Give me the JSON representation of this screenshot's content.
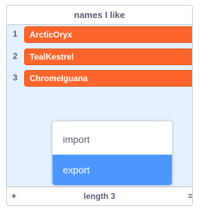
{
  "list": {
    "title": "names I like",
    "items": [
      {
        "index": "1",
        "value": "ArcticOryx"
      },
      {
        "index": "2",
        "value": "TealKestrel"
      },
      {
        "index": "3",
        "value": "ChromeIguana"
      }
    ],
    "footer": {
      "add_label": "+",
      "length_text": "length 3",
      "resize_label": "="
    }
  },
  "context_menu": {
    "items": [
      {
        "label": "import",
        "highlighted": false
      },
      {
        "label": "export",
        "highlighted": true
      }
    ]
  },
  "colors": {
    "item_bg": "#fc662c",
    "list_bg": "#e5f0ff",
    "highlight": "#4c97ff",
    "text": "#575e75"
  }
}
